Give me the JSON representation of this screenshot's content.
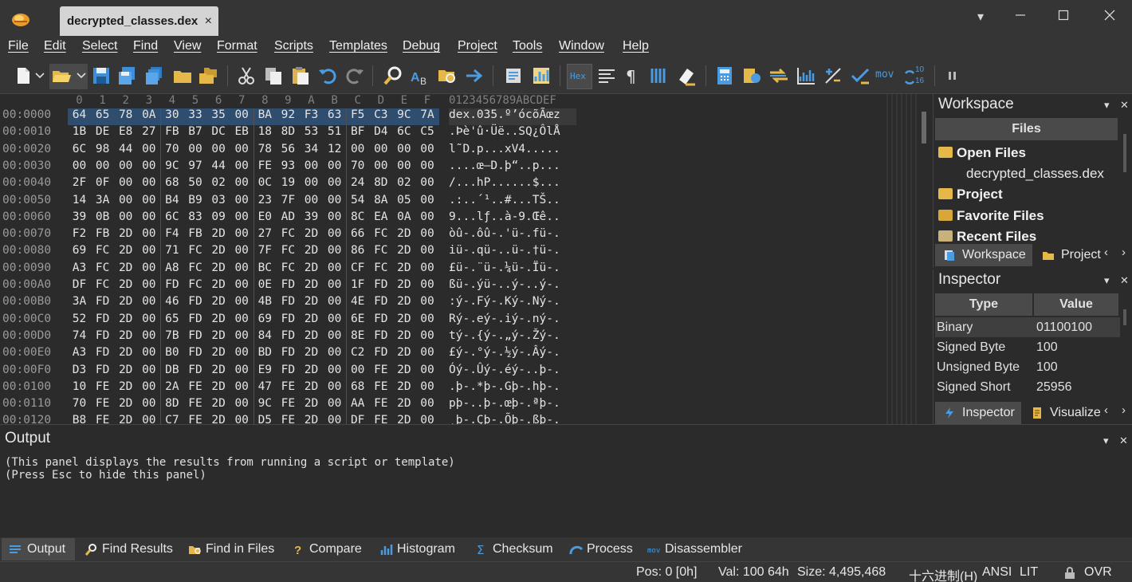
{
  "window": {
    "tab_title": "decrypted_classes.dex",
    "tab_close": "×",
    "minimize": "▭",
    "restore": "☐",
    "close": "✕",
    "dropdown": "▾"
  },
  "menu": [
    "File",
    "Edit",
    "Select",
    "Find",
    "View",
    "Format",
    "Scripts",
    "Templates",
    "Debug",
    "Project",
    "Tools",
    "Window",
    "Help"
  ],
  "toolbar": {
    "icons": [
      "new-file-icon",
      "open-file-icon",
      "save-icon",
      "save-as-icon",
      "save-all-icon",
      "open-folder-icon",
      "open-multiple-icon",
      "cut-icon",
      "copy-icon",
      "paste-icon",
      "undo-icon",
      "redo-icon",
      "find-icon",
      "replace-icon",
      "find-in-files-icon",
      "goto-icon",
      "compare-icon",
      "histogram-icon",
      "hex-mode-icon",
      "text-format-icon",
      "pilcrow-icon",
      "columns-icon",
      "highlight-icon",
      "calculator-icon",
      "edit-as-icon",
      "swap-icon",
      "chart-icon",
      "plus-minus-icon",
      "checksum-icon",
      "disassembler-icon",
      "base-convert-icon",
      "pause-icon"
    ],
    "hex_label": "Hex",
    "mov_label": "mov",
    "base_label_top": "10",
    "base_label_bottom": "16"
  },
  "hex": {
    "column_headers": [
      "0",
      "1",
      "2",
      "3",
      "4",
      "5",
      "6",
      "7",
      "8",
      "9",
      "A",
      "B",
      "C",
      "D",
      "E",
      "F"
    ],
    "ascii_header": "0123456789ABCDEF",
    "rows": [
      {
        "addr": "00:0000",
        "bytes": [
          "64",
          "65",
          "78",
          "0A",
          "30",
          "33",
          "35",
          "00",
          "BA",
          "92",
          "F3",
          "63",
          "F5",
          "C3",
          "9C",
          "7A"
        ],
        "ascii": "dex.035.º’ócõÃœz"
      },
      {
        "addr": "00:0010",
        "bytes": [
          "1B",
          "DE",
          "E8",
          "27",
          "FB",
          "B7",
          "DC",
          "EB",
          "18",
          "8D",
          "53",
          "51",
          "BF",
          "D4",
          "6C",
          "C5"
        ],
        "ascii": ".Þè'û·Üë..SQ¿ÔlÅ"
      },
      {
        "addr": "00:0020",
        "bytes": [
          "6C",
          "98",
          "44",
          "00",
          "70",
          "00",
          "00",
          "00",
          "78",
          "56",
          "34",
          "12",
          "00",
          "00",
          "00",
          "00"
        ],
        "ascii": "l˜D.p...xV4....."
      },
      {
        "addr": "00:0030",
        "bytes": [
          "00",
          "00",
          "00",
          "00",
          "9C",
          "97",
          "44",
          "00",
          "FE",
          "93",
          "00",
          "00",
          "70",
          "00",
          "00",
          "00"
        ],
        "ascii": "....œ—D.þ“..p..."
      },
      {
        "addr": "00:0040",
        "bytes": [
          "2F",
          "0F",
          "00",
          "00",
          "68",
          "50",
          "02",
          "00",
          "0C",
          "19",
          "00",
          "00",
          "24",
          "8D",
          "02",
          "00"
        ],
        "ascii": "/...hP......$..."
      },
      {
        "addr": "00:0050",
        "bytes": [
          "14",
          "3A",
          "00",
          "00",
          "B4",
          "B9",
          "03",
          "00",
          "23",
          "7F",
          "00",
          "00",
          "54",
          "8A",
          "05",
          "00"
        ],
        "ascii": ".:..´¹..#...TŠ.."
      },
      {
        "addr": "00:0060",
        "bytes": [
          "39",
          "0B",
          "00",
          "00",
          "6C",
          "83",
          "09",
          "00",
          "E0",
          "AD",
          "39",
          "00",
          "8C",
          "EA",
          "0A",
          "00"
        ],
        "ascii": "9...lƒ..à-9.Œê.."
      },
      {
        "addr": "00:0070",
        "bytes": [
          "F2",
          "FB",
          "2D",
          "00",
          "F4",
          "FB",
          "2D",
          "00",
          "27",
          "FC",
          "2D",
          "00",
          "66",
          "FC",
          "2D",
          "00"
        ],
        "ascii": "òû-.ôû-.'ü-.fü-."
      },
      {
        "addr": "00:0080",
        "bytes": [
          "69",
          "FC",
          "2D",
          "00",
          "71",
          "FC",
          "2D",
          "00",
          "7F",
          "FC",
          "2D",
          "00",
          "86",
          "FC",
          "2D",
          "00"
        ],
        "ascii": "iü-.qü-..ü-.†ü-."
      },
      {
        "addr": "00:0090",
        "bytes": [
          "A3",
          "FC",
          "2D",
          "00",
          "A8",
          "FC",
          "2D",
          "00",
          "BC",
          "FC",
          "2D",
          "00",
          "CF",
          "FC",
          "2D",
          "00"
        ],
        "ascii": "£ü-.¨ü-.¼ü-.Ïü-."
      },
      {
        "addr": "00:00A0",
        "bytes": [
          "DF",
          "FC",
          "2D",
          "00",
          "FD",
          "FC",
          "2D",
          "00",
          "0E",
          "FD",
          "2D",
          "00",
          "1F",
          "FD",
          "2D",
          "00"
        ],
        "ascii": "ßü-.ýü-..ý-..ý-."
      },
      {
        "addr": "00:00B0",
        "bytes": [
          "3A",
          "FD",
          "2D",
          "00",
          "46",
          "FD",
          "2D",
          "00",
          "4B",
          "FD",
          "2D",
          "00",
          "4E",
          "FD",
          "2D",
          "00"
        ],
        "ascii": ":ý-.Fý-.Ký-.Ný-."
      },
      {
        "addr": "00:00C0",
        "bytes": [
          "52",
          "FD",
          "2D",
          "00",
          "65",
          "FD",
          "2D",
          "00",
          "69",
          "FD",
          "2D",
          "00",
          "6E",
          "FD",
          "2D",
          "00"
        ],
        "ascii": "Rý-.eý-.iý-.ný-."
      },
      {
        "addr": "00:00D0",
        "bytes": [
          "74",
          "FD",
          "2D",
          "00",
          "7B",
          "FD",
          "2D",
          "00",
          "84",
          "FD",
          "2D",
          "00",
          "8E",
          "FD",
          "2D",
          "00"
        ],
        "ascii": "tý-.{ý-.„ý-.Žý-."
      },
      {
        "addr": "00:00E0",
        "bytes": [
          "A3",
          "FD",
          "2D",
          "00",
          "B0",
          "FD",
          "2D",
          "00",
          "BD",
          "FD",
          "2D",
          "00",
          "C2",
          "FD",
          "2D",
          "00"
        ],
        "ascii": "£ý-.°ý-.½ý-.Âý-."
      },
      {
        "addr": "00:00F0",
        "bytes": [
          "D3",
          "FD",
          "2D",
          "00",
          "DB",
          "FD",
          "2D",
          "00",
          "E9",
          "FD",
          "2D",
          "00",
          "00",
          "FE",
          "2D",
          "00"
        ],
        "ascii": "Óý-.Ûý-.éý-..þ-."
      },
      {
        "addr": "00:0100",
        "bytes": [
          "10",
          "FE",
          "2D",
          "00",
          "2A",
          "FE",
          "2D",
          "00",
          "47",
          "FE",
          "2D",
          "00",
          "68",
          "FE",
          "2D",
          "00"
        ],
        "ascii": ".þ-.*þ-.Gþ-.hþ-."
      },
      {
        "addr": "00:0110",
        "bytes": [
          "70",
          "FE",
          "2D",
          "00",
          "8D",
          "FE",
          "2D",
          "00",
          "9C",
          "FE",
          "2D",
          "00",
          "AA",
          "FE",
          "2D",
          "00"
        ],
        "ascii": "pþ-..þ-.œþ-.ªþ-."
      },
      {
        "addr": "00:0120",
        "bytes": [
          "B8",
          "FE",
          "2D",
          "00",
          "C7",
          "FE",
          "2D",
          "00",
          "D5",
          "FE",
          "2D",
          "00",
          "DF",
          "FE",
          "2D",
          "00"
        ],
        "ascii": "¸þ-.Çþ-.Õþ-.ßþ-."
      }
    ]
  },
  "workspace": {
    "title": "Workspace",
    "files_header": "Files",
    "open_files": "Open Files",
    "open_file_item": "decrypted_classes.dex",
    "project": "Project",
    "favorite_files": "Favorite Files",
    "recent_files": "Recent Files",
    "tab_workspace": "Workspace",
    "tab_project": "Project",
    "pin": "▾",
    "close": "✕",
    "arrow_left": "‹",
    "arrow_right": "›"
  },
  "inspector": {
    "title": "Inspector",
    "col_type": "Type",
    "col_value": "Value",
    "rows": [
      {
        "type": "Binary",
        "value": "01100100"
      },
      {
        "type": "Signed Byte",
        "value": "100"
      },
      {
        "type": "Unsigned Byte",
        "value": "100"
      },
      {
        "type": "Signed Short",
        "value": "25956"
      }
    ],
    "tab_inspector": "Inspector",
    "tab_visualize": "Visualize"
  },
  "output": {
    "title": "Output",
    "lines": [
      "(This panel displays the results from running a script or template)",
      "(Press Esc to hide this panel)"
    ]
  },
  "bottom_tabs": [
    "Output",
    "Find Results",
    "Find in Files",
    "Compare",
    "Histogram",
    "Checksum",
    "Process",
    "Disassembler"
  ],
  "status": {
    "pos": "Pos: 0 [0h]",
    "val": "Val: 100 64h",
    "size": "Size: 4,495,468",
    "encoding": "十六进制(H)",
    "charset": "ANSI",
    "endian": "LIT",
    "mode": "OVR"
  },
  "colors": {
    "background": "#2b2b2b",
    "chrome": "#353535",
    "selection": "#2f4d6e",
    "header_bg": "#4a4a4a",
    "tab_active": "#d4d4d4",
    "folder": "#e6b84a",
    "accent_blue": "#4a9be0"
  }
}
